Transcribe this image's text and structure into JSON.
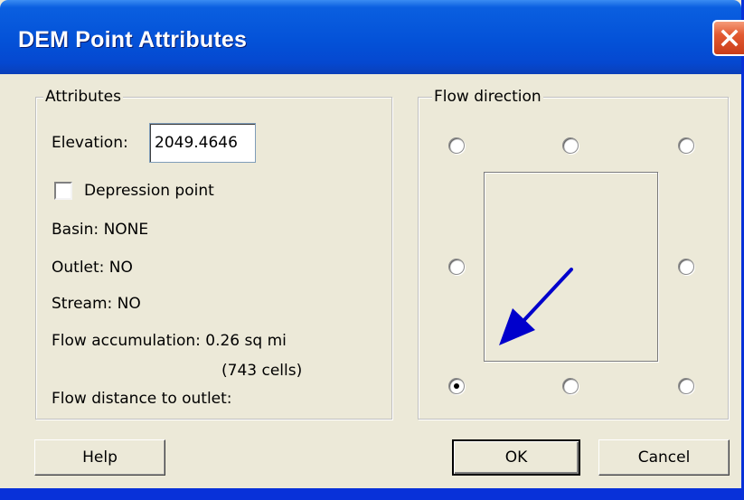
{
  "window": {
    "title": "DEM Point Attributes"
  },
  "attributes": {
    "group_label": "Attributes",
    "elevation_label": "Elevation:",
    "elevation_value": "2049.4646",
    "depression_point_label": "Depression point",
    "depression_point_checked": false,
    "basin": "Basin:  NONE",
    "outlet": "Outlet:  NO",
    "stream": "Stream:  NO",
    "flow_accumulation": "Flow accumulation:  0.26 sq mi",
    "flow_cells": "(743 cells)",
    "flow_distance": "Flow distance to outlet:"
  },
  "flow_direction": {
    "group_label": "Flow direction",
    "selected": "southwest",
    "options": [
      "northwest",
      "north",
      "northeast",
      "west",
      "east",
      "southwest",
      "south",
      "southeast"
    ],
    "arrow_color": "#0000cc"
  },
  "buttons": {
    "help": "Help",
    "ok": "OK",
    "cancel": "Cancel"
  },
  "colors": {
    "titlebar": "#0452d8",
    "dialog_bg": "#ece9d8",
    "close_button": "#e35a32"
  }
}
